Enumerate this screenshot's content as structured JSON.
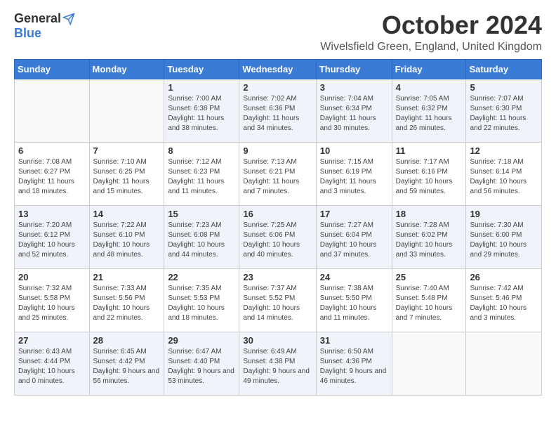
{
  "logo": {
    "general": "General",
    "blue": "Blue"
  },
  "title": "October 2024",
  "location": "Wivelsfield Green, England, United Kingdom",
  "days_of_week": [
    "Sunday",
    "Monday",
    "Tuesday",
    "Wednesday",
    "Thursday",
    "Friday",
    "Saturday"
  ],
  "weeks": [
    [
      {
        "day": "",
        "info": ""
      },
      {
        "day": "",
        "info": ""
      },
      {
        "day": "1",
        "info": "Sunrise: 7:00 AM\nSunset: 6:38 PM\nDaylight: 11 hours and 38 minutes."
      },
      {
        "day": "2",
        "info": "Sunrise: 7:02 AM\nSunset: 6:36 PM\nDaylight: 11 hours and 34 minutes."
      },
      {
        "day": "3",
        "info": "Sunrise: 7:04 AM\nSunset: 6:34 PM\nDaylight: 11 hours and 30 minutes."
      },
      {
        "day": "4",
        "info": "Sunrise: 7:05 AM\nSunset: 6:32 PM\nDaylight: 11 hours and 26 minutes."
      },
      {
        "day": "5",
        "info": "Sunrise: 7:07 AM\nSunset: 6:30 PM\nDaylight: 11 hours and 22 minutes."
      }
    ],
    [
      {
        "day": "6",
        "info": "Sunrise: 7:08 AM\nSunset: 6:27 PM\nDaylight: 11 hours and 18 minutes."
      },
      {
        "day": "7",
        "info": "Sunrise: 7:10 AM\nSunset: 6:25 PM\nDaylight: 11 hours and 15 minutes."
      },
      {
        "day": "8",
        "info": "Sunrise: 7:12 AM\nSunset: 6:23 PM\nDaylight: 11 hours and 11 minutes."
      },
      {
        "day": "9",
        "info": "Sunrise: 7:13 AM\nSunset: 6:21 PM\nDaylight: 11 hours and 7 minutes."
      },
      {
        "day": "10",
        "info": "Sunrise: 7:15 AM\nSunset: 6:19 PM\nDaylight: 11 hours and 3 minutes."
      },
      {
        "day": "11",
        "info": "Sunrise: 7:17 AM\nSunset: 6:16 PM\nDaylight: 10 hours and 59 minutes."
      },
      {
        "day": "12",
        "info": "Sunrise: 7:18 AM\nSunset: 6:14 PM\nDaylight: 10 hours and 56 minutes."
      }
    ],
    [
      {
        "day": "13",
        "info": "Sunrise: 7:20 AM\nSunset: 6:12 PM\nDaylight: 10 hours and 52 minutes."
      },
      {
        "day": "14",
        "info": "Sunrise: 7:22 AM\nSunset: 6:10 PM\nDaylight: 10 hours and 48 minutes."
      },
      {
        "day": "15",
        "info": "Sunrise: 7:23 AM\nSunset: 6:08 PM\nDaylight: 10 hours and 44 minutes."
      },
      {
        "day": "16",
        "info": "Sunrise: 7:25 AM\nSunset: 6:06 PM\nDaylight: 10 hours and 40 minutes."
      },
      {
        "day": "17",
        "info": "Sunrise: 7:27 AM\nSunset: 6:04 PM\nDaylight: 10 hours and 37 minutes."
      },
      {
        "day": "18",
        "info": "Sunrise: 7:28 AM\nSunset: 6:02 PM\nDaylight: 10 hours and 33 minutes."
      },
      {
        "day": "19",
        "info": "Sunrise: 7:30 AM\nSunset: 6:00 PM\nDaylight: 10 hours and 29 minutes."
      }
    ],
    [
      {
        "day": "20",
        "info": "Sunrise: 7:32 AM\nSunset: 5:58 PM\nDaylight: 10 hours and 25 minutes."
      },
      {
        "day": "21",
        "info": "Sunrise: 7:33 AM\nSunset: 5:56 PM\nDaylight: 10 hours and 22 minutes."
      },
      {
        "day": "22",
        "info": "Sunrise: 7:35 AM\nSunset: 5:53 PM\nDaylight: 10 hours and 18 minutes."
      },
      {
        "day": "23",
        "info": "Sunrise: 7:37 AM\nSunset: 5:52 PM\nDaylight: 10 hours and 14 minutes."
      },
      {
        "day": "24",
        "info": "Sunrise: 7:38 AM\nSunset: 5:50 PM\nDaylight: 10 hours and 11 minutes."
      },
      {
        "day": "25",
        "info": "Sunrise: 7:40 AM\nSunset: 5:48 PM\nDaylight: 10 hours and 7 minutes."
      },
      {
        "day": "26",
        "info": "Sunrise: 7:42 AM\nSunset: 5:46 PM\nDaylight: 10 hours and 3 minutes."
      }
    ],
    [
      {
        "day": "27",
        "info": "Sunrise: 6:43 AM\nSunset: 4:44 PM\nDaylight: 10 hours and 0 minutes."
      },
      {
        "day": "28",
        "info": "Sunrise: 6:45 AM\nSunset: 4:42 PM\nDaylight: 9 hours and 56 minutes."
      },
      {
        "day": "29",
        "info": "Sunrise: 6:47 AM\nSunset: 4:40 PM\nDaylight: 9 hours and 53 minutes."
      },
      {
        "day": "30",
        "info": "Sunrise: 6:49 AM\nSunset: 4:38 PM\nDaylight: 9 hours and 49 minutes."
      },
      {
        "day": "31",
        "info": "Sunrise: 6:50 AM\nSunset: 4:36 PM\nDaylight: 9 hours and 46 minutes."
      },
      {
        "day": "",
        "info": ""
      },
      {
        "day": "",
        "info": ""
      }
    ]
  ]
}
